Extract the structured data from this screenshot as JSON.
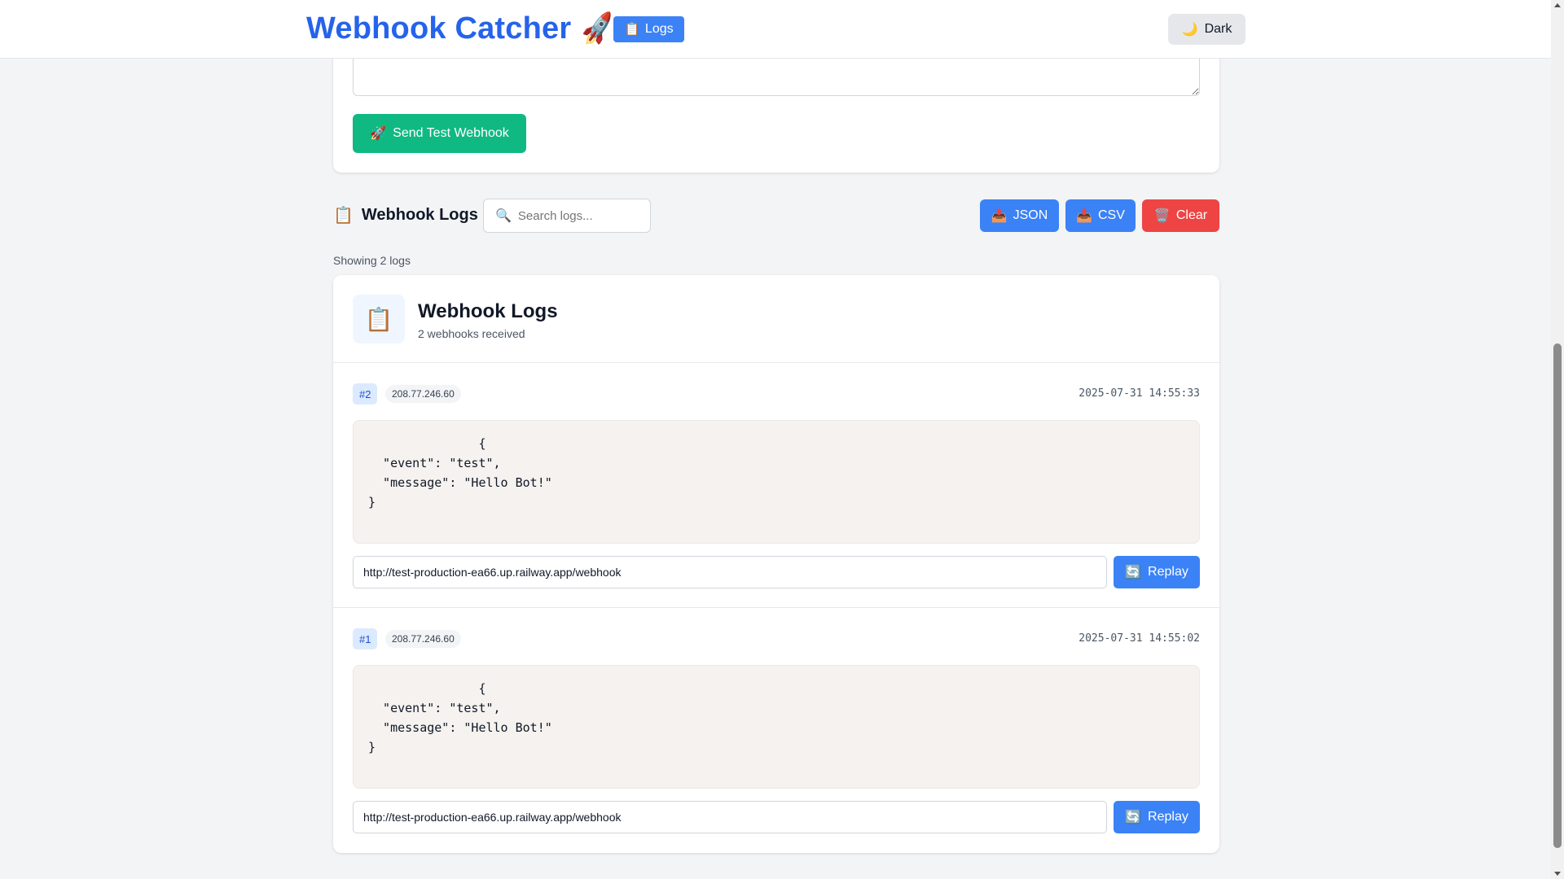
{
  "header": {
    "brand": "Webhook Catcher",
    "brand_icon": "🚀",
    "logs_label": "Logs",
    "logs_icon": "📋",
    "theme_label": "Dark",
    "theme_icon": "🌙"
  },
  "sender": {
    "payload_value": "",
    "send_label": "Send Test Webhook",
    "send_icon": "🚀"
  },
  "logs_toolbar": {
    "title": "Webhook Logs",
    "title_icon": "📋",
    "search_placeholder": "Search logs...",
    "search_icon": "🔍",
    "json_label": "JSON",
    "csv_label": "CSV",
    "clear_label": "Clear",
    "export_icon": "📤",
    "clear_icon": "🗑️"
  },
  "showing_text": "Showing 2 logs",
  "logs_card": {
    "title": "Webhook Logs",
    "subtitle": "2 webhooks received",
    "icon": "📋"
  },
  "entries": [
    {
      "id": "#2",
      "ip": "208.77.246.60",
      "timestamp": "2025-07-31 14:55:33",
      "body": "               {\n  \"event\": \"test\",\n  \"message\": \"Hello Bot!\"\n}",
      "replay_url": "http://test-production-ea66.up.railway.app/webhook",
      "replay_label": "Replay",
      "replay_icon": "🔄"
    },
    {
      "id": "#1",
      "ip": "208.77.246.60",
      "timestamp": "2025-07-31 14:55:02",
      "body": "               {\n  \"event\": \"test\",\n  \"message\": \"Hello Bot!\"\n}",
      "replay_url": "http://test-production-ea66.up.railway.app/webhook",
      "replay_label": "Replay",
      "replay_icon": "🔄"
    }
  ],
  "colors": {
    "brand": "#2563eb",
    "primary": "#3b82f6",
    "success": "#10b981",
    "danger": "#ef4444"
  }
}
